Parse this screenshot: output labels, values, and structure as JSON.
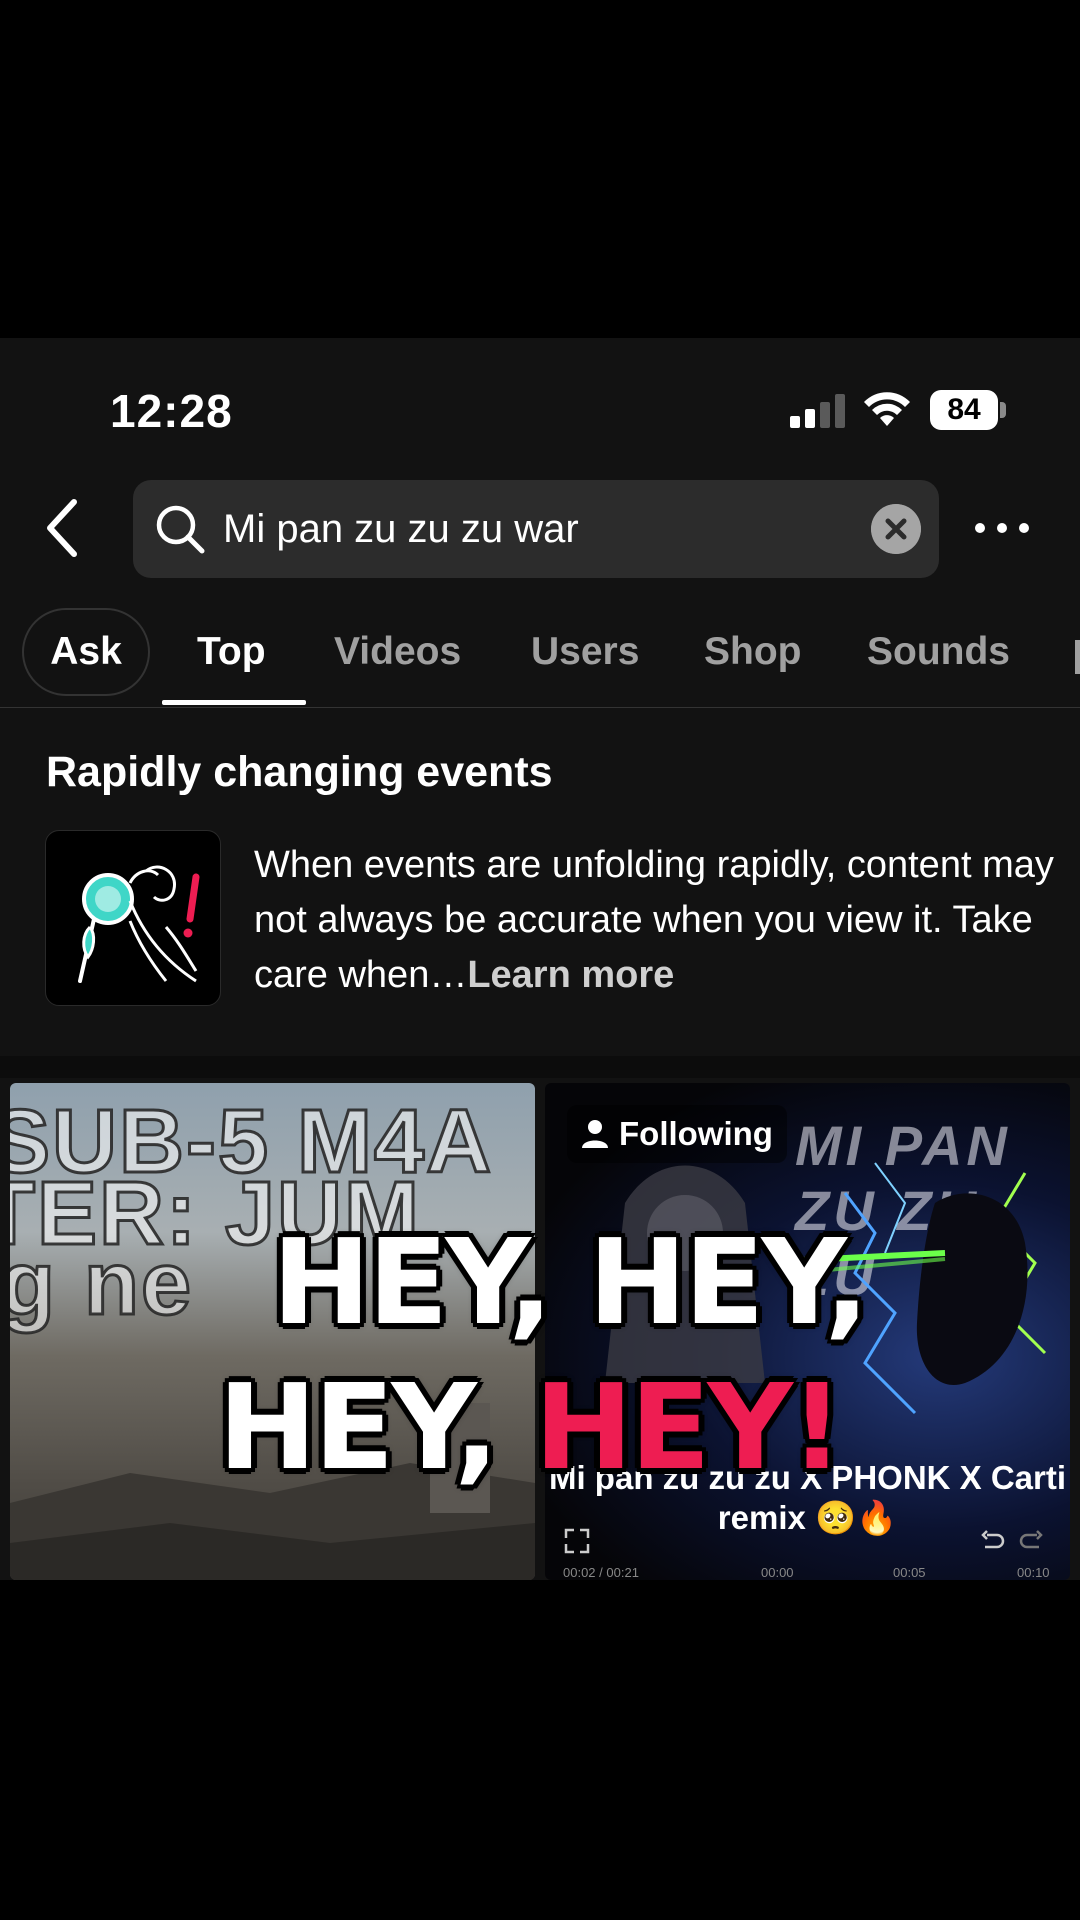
{
  "status_bar": {
    "time": "12:28",
    "battery": "84"
  },
  "search": {
    "query": "Mi pan zu zu zu war"
  },
  "tabs": [
    {
      "label": "Ask"
    },
    {
      "label": "Top"
    },
    {
      "label": "Videos"
    },
    {
      "label": "Users"
    },
    {
      "label": "Shop"
    },
    {
      "label": "Sounds"
    }
  ],
  "active_tab": "Top",
  "notice": {
    "title": "Rapidly changing events",
    "body": "When events are unfolding rapidly, content may not always be accurate when you view it. Take care when…",
    "link": "Learn more"
  },
  "videos": {
    "left": {
      "bg_text_1": "SUB-5 M4A",
      "bg_text_2": "TER: JUM",
      "bg_text_3": "g ne"
    },
    "right": {
      "badge": "Following",
      "bg_title": "MI PAN ZU ZU ZU",
      "caption": "Mi pan zu zu zu X PHONK X Carti remix 🥺🔥",
      "time_current": "00:02",
      "time_total": "00:21",
      "ticks": [
        "00:00",
        "00:05",
        "00:10"
      ]
    }
  },
  "overlay": {
    "line1": "HEY, HEY,",
    "line2_white": "HEY, ",
    "line2_pink": "HEY!"
  },
  "colors": {
    "accent_pink": "#ee1d52",
    "background": "#121212",
    "search_bg": "#2c2c2c"
  },
  "icons": [
    "back-icon",
    "search-icon",
    "clear-icon",
    "more-icon",
    "person-icon",
    "fullscreen-icon",
    "undo-icon",
    "redo-icon"
  ]
}
